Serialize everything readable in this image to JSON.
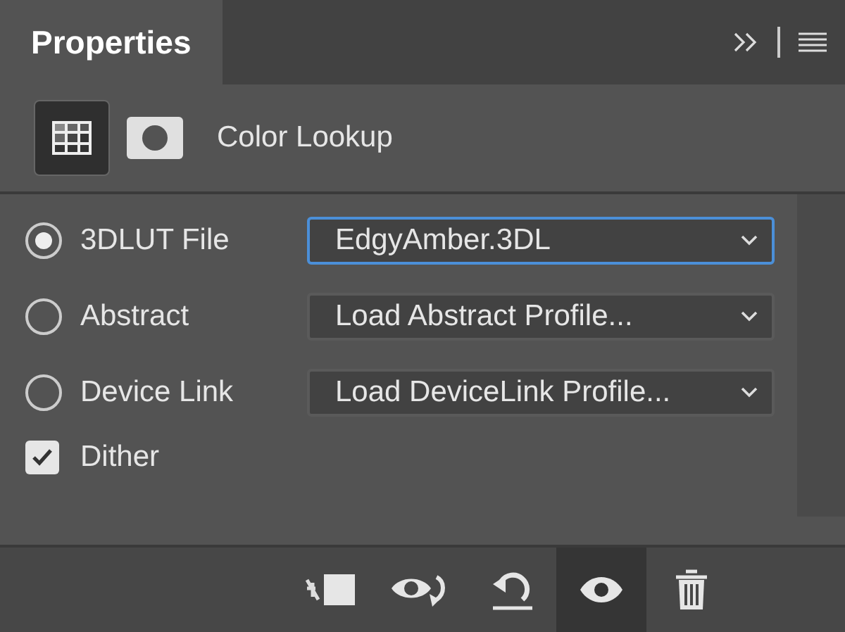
{
  "tab": {
    "label": "Properties",
    "selected": true
  },
  "icon_tabs": [
    {
      "kind": "adjustment",
      "selected": true
    },
    {
      "kind": "mask",
      "selected": false
    }
  ],
  "title": "Color Lookup",
  "options": [
    {
      "label": "3DLUT File",
      "selected": true,
      "value": "EdgyAmber.3DL",
      "focused": true
    },
    {
      "label": "Abstract",
      "selected": false,
      "value": "Load Abstract Profile...",
      "focused": false
    },
    {
      "label": "Device Link",
      "selected": false,
      "value": "Load DeviceLink Profile...",
      "focused": false
    }
  ],
  "dither": {
    "label": "Dither",
    "checked": true
  },
  "toolbar": [
    {
      "kind": "clip",
      "pressed": false
    },
    {
      "kind": "view-previous",
      "pressed": false
    },
    {
      "kind": "reset",
      "pressed": false
    },
    {
      "kind": "visibility",
      "pressed": true
    },
    {
      "kind": "delete",
      "pressed": false
    }
  ]
}
